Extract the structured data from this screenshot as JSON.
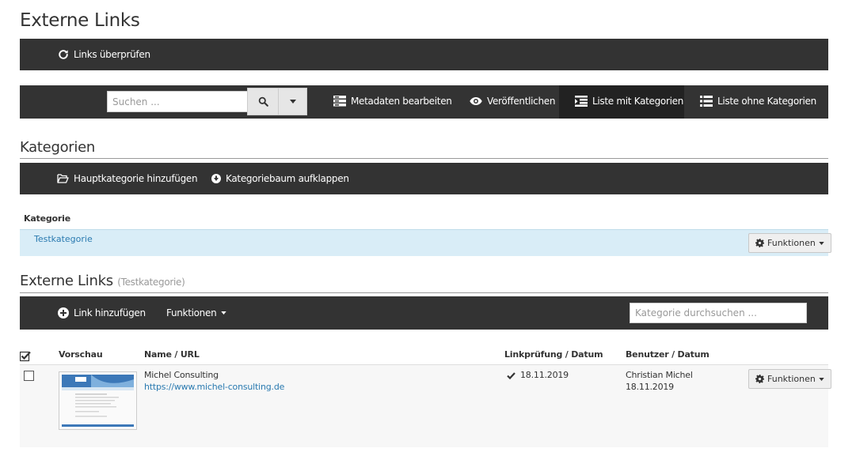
{
  "page": {
    "title": "Externe Links"
  },
  "toolbar_top": {
    "check_links_label": "Links überprüfen"
  },
  "toolbar_main": {
    "search_placeholder": "Suchen ...",
    "edit_metadata_label": "Metadaten bearbeiten",
    "publish_label": "Veröffentlichen",
    "list_with_categories_label": "Liste mit Kategorien",
    "list_without_categories_label": "Liste ohne Kategorien"
  },
  "categories": {
    "title": "Kategorien",
    "add_main_category_label": "Hauptkategorie hinzufügen",
    "expand_tree_label": "Kategoriebaum aufklappen",
    "column_header": "Kategorie",
    "rows": [
      {
        "name": "Testkategorie",
        "functions_label": "Funktionen"
      }
    ]
  },
  "links": {
    "title": "Externe Links",
    "subtitle": "(Testkategorie)",
    "add_link_label": "Link hinzufügen",
    "functions_label": "Funktionen",
    "category_search_placeholder": "Kategorie durchsuchen ...",
    "columns": {
      "preview": "Vorschau",
      "name_url": "Name / URL",
      "check_date": "Linkprüfung / Datum",
      "user_date": "Benutzer / Datum"
    },
    "rows": [
      {
        "name": "Michel Consulting",
        "url": "https://www.michel-consulting.de",
        "check_date": "18.11.2019",
        "user": "Christian Michel",
        "user_date": "18.11.2019",
        "functions_label": "Funktionen"
      }
    ]
  },
  "colors": {
    "toolbar_bg": "#333333",
    "active_tab_bg": "#222222",
    "link": "#2a7ab0",
    "category_row_bg": "#d9edf7"
  }
}
